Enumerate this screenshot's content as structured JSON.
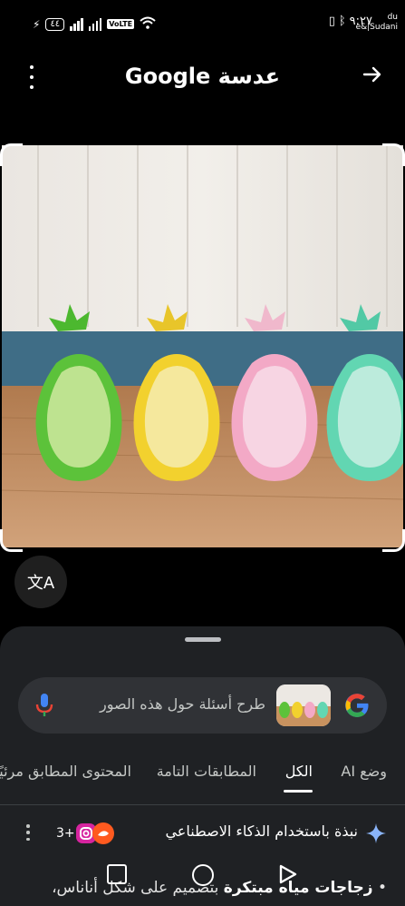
{
  "status_bar": {
    "battery": "٤٤",
    "volte": "VoLTE",
    "time": "٩:٢٧",
    "carrier_line1": "du",
    "carrier_line2": "e&|Sudani"
  },
  "top_bar": {
    "title": "Google عدسة",
    "menu_icon": "kebab-icon",
    "share_icon": "arrow-right-icon"
  },
  "image": {
    "description_icon": "photo",
    "bottle_colors": [
      "#5cc23a",
      "#f2d12e",
      "#f3a9c6",
      "#62d6b2"
    ]
  },
  "translate_button": {
    "icon": "translate-icon",
    "glyph": "文A"
  },
  "search": {
    "placeholder": "طرح أسئلة حول هذه الصور",
    "google_colors": [
      "#4285F4",
      "#EA4335",
      "#FBBC05",
      "#34A853"
    ]
  },
  "tabs": [
    {
      "label": "وضع AI",
      "active": false
    },
    {
      "label": "الكل",
      "active": true
    },
    {
      "label": "المطابقات التامة",
      "active": false
    },
    {
      "label": "المحتوى المطابق مرئيًا",
      "active": false
    }
  ],
  "ai_overview": {
    "label": "نبذة باستخدام الذكاء الاصطناعي",
    "source_count": "3+"
  },
  "snippet": {
    "bold": "زجاجات مياه مبتكرة",
    "rest": " بتصميم على شكل أناناس،"
  }
}
